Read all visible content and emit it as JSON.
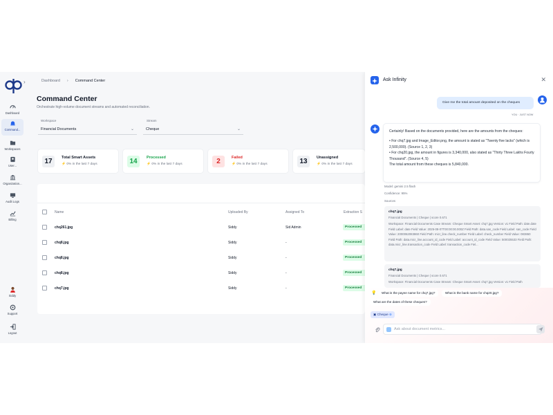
{
  "sidebar": {
    "items": [
      {
        "label": "Dashboard",
        "icon": "gauge-icon"
      },
      {
        "label": "Command...",
        "icon": "bell-icon",
        "active": true
      },
      {
        "label": "Workspaces",
        "icon": "folder-icon"
      },
      {
        "label": "User...",
        "icon": "user-list-icon"
      },
      {
        "label": "Organization...",
        "icon": "building-icon"
      },
      {
        "label": "Audit Logs",
        "icon": "monitor-icon"
      },
      {
        "label": "Billing",
        "icon": "chart-icon"
      }
    ],
    "bottom": [
      {
        "label": "Siddy",
        "icon": "avatar"
      },
      {
        "label": "Support",
        "icon": "gear-icon"
      },
      {
        "label": "Logout",
        "icon": "logout-icon"
      }
    ]
  },
  "breadcrumb": {
    "home": "Dashboard",
    "sep": "›",
    "current": "Command Center"
  },
  "page": {
    "title": "Command Center",
    "subtitle": "Orchestrate high-volume document streams and automated reconciliation."
  },
  "filters": {
    "workspace_label": "Workspace",
    "workspace_value": "Financial Documents",
    "stream_label": "Stream",
    "stream_value": "Cheque"
  },
  "stats": [
    {
      "value": "17",
      "title": "Total Smart Assets",
      "delta": "0% in the last 7 days",
      "color": "#111827",
      "bg": "#eef0f3"
    },
    {
      "value": "14",
      "title": "Processed",
      "delta": "0% in the last 7 days",
      "color": "#16a34a",
      "bg": "#dcfce7"
    },
    {
      "value": "2",
      "title": "Failed",
      "delta": "0% in the last 7 days",
      "color": "#dc2626",
      "bg": "#fee2e2"
    },
    {
      "value": "13",
      "title": "Unassigned",
      "delta": "0% in the last 7 days",
      "color": "#111827",
      "bg": "#eef0f3"
    }
  ],
  "table": {
    "headers": [
      "Name",
      "Uploaded By",
      "Assigned To",
      "Extraction S"
    ],
    "rows": [
      {
        "name": "chq261.jpg",
        "uploaded_by": "Siddy",
        "assigned_to": "Sid Admin",
        "status": "Processed"
      },
      {
        "name": "chq8.jpg",
        "uploaded_by": "Siddy",
        "assigned_to": "-",
        "status": "Processed"
      },
      {
        "name": "chq8.jpg",
        "uploaded_by": "Siddy",
        "assigned_to": "-",
        "status": "Processed"
      },
      {
        "name": "chq8.jpg",
        "uploaded_by": "Siddy",
        "assigned_to": "-",
        "status": "Processed"
      },
      {
        "name": "chq7.jpg",
        "uploaded_by": "Siddy",
        "assigned_to": "-",
        "status": "Processed"
      }
    ]
  },
  "chat": {
    "title": "Ask Infinity",
    "user_message": "Give me the total amount deposited on the cheques",
    "user_meta": "YOU · JUST NOW",
    "bot_message": {
      "intro": "Certainly! Based on the documents provided, here are the amounts from the cheques:",
      "point1": "• For chq7.jpg and Image_Editor.png, the amount is stated as \"Twenty five lacks\" (which is 2,500,000). (Source 1, 2, 3)",
      "point2": "• For chq20.jpg, the amount in figures is 3,340,000, also stated as \"Thirty Three Lakhs Fourty Thousand\". (Source 4, 5)",
      "total": "The total amount from these cheques is 5,840,000."
    },
    "model": "Model: gemini 2.5 flash",
    "confidence": "Confidence: 95%",
    "sources_label": "Sources",
    "sources": [
      {
        "name": "chq7.jpg",
        "path": "Financial Documents | Cheque | score 0.671",
        "detail": "Workspace: Financial Documents Case Stream: Cheque Smart Asset: chq7.jpg Version: v1 Field Path: date.date Field Label: date Field Value: 2025-08-07T00:00:00.000Z Field Path: data.san_code Field Label: san_code Field Value: 2000062083860 Field Path: micr_line.check_number Field Label: check_number Field Value: 083860 Field Path: data.micr_line.account_id_code Field Label: account_id_code Field Value: 500025533 Field Path: data.micr_line.transaction_code Field Label: transaction_code Fiel..."
      },
      {
        "name": "chq7.jpg",
        "path": "Financial Documents | Cheque | score 0.671",
        "detail": "Workspace: Financial Documents Case Stream: Cheque Smart Asset: chq7.jpg Version: v1 Field Path"
      }
    ],
    "suggestions": [
      "What is the payee name for chq7.jpg?",
      "What is the bank name for chq20.jpg?",
      "What are the dates of these cheques?"
    ],
    "context_tag": "Cheque",
    "input_placeholder": "Ask about document metrics..."
  }
}
